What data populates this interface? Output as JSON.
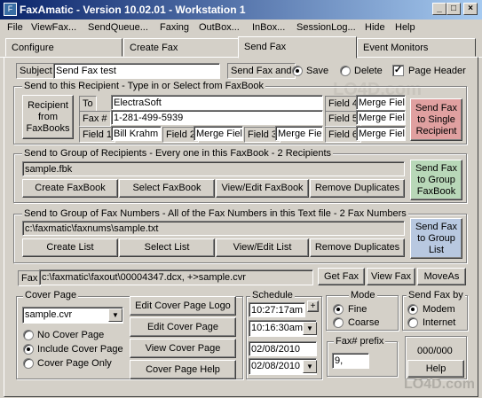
{
  "window": {
    "title": "FaxAmatic - Version 10.02.01 - Workstation 1",
    "icon": "fax-app-icon"
  },
  "menu": [
    "File",
    "ViewFax...",
    "SendQueue...",
    "Faxing",
    "OutBox...",
    "InBox...",
    "SessionLog...",
    "Hide",
    "Help"
  ],
  "tabs": [
    "Configure",
    "Create Fax",
    "Send Fax",
    "Event Monitors"
  ],
  "active_tab": "Send Fax",
  "subject": {
    "label": "Subject",
    "value": "Send Fax test"
  },
  "send_fax_and": {
    "label": "Send Fax and",
    "save_label": "Save",
    "delete_label": "Delete",
    "selected": "Save"
  },
  "page_header": {
    "label": "Page Header",
    "checked": true
  },
  "recipient": {
    "group_title": "Send to this Recipient - Type in or Select from FaxBook",
    "faxbooks_button": "Recipient from FaxBooks",
    "to_label": "To",
    "to_value": "ElectraSoft",
    "fax_label": "Fax #",
    "fax_value": "1-281-499-5939",
    "field1_label": "Field 1",
    "field1_value": "Bill Krahm",
    "field2_label": "Field 2",
    "field2_value": "Merge Fiel",
    "field3_label": "Field 3",
    "field3_value": "Merge Fiel",
    "field4_label": "Field 4",
    "field4_value": "Merge Fiel",
    "field5_label": "Field 5",
    "field5_value": "Merge Fiel",
    "field6_label": "Field 6",
    "field6_value": "Merge Fiel",
    "send_button": "Send Fax to Single Recipient"
  },
  "group_recipients": {
    "title": "Send to Group of Recipients - Every one in this FaxBook - 2 Recipients",
    "file": "sample.fbk",
    "buttons": [
      "Create FaxBook",
      "Select FaxBook",
      "View/Edit FaxBook",
      "Remove Duplicates"
    ],
    "send_button": "Send Fax to Group FaxBook"
  },
  "group_numbers": {
    "title": "Send to Group of Fax Numbers - All of the Fax Numbers in this Text file - 2 Fax Numbers",
    "file": "c:\\faxmatic\\faxnums\\sample.txt",
    "buttons": [
      "Create List",
      "Select List",
      "View/Edit List",
      "Remove Duplicates"
    ],
    "send_button": "Send Fax to Group List"
  },
  "fax_file": {
    "label": "Fax",
    "value": "c:\\faxmatic\\faxout\\00004347.dcx, +>sample.cvr",
    "buttons": [
      "Get Fax",
      "View Fax",
      "MoveAs"
    ]
  },
  "cover_page": {
    "title": "Cover Page",
    "selected": "sample.cvr",
    "options": [
      "No Cover Page",
      "Include Cover Page",
      "Cover Page Only"
    ],
    "selected_option": "Include Cover Page",
    "buttons": [
      "Edit Cover Page Logo",
      "Edit Cover Page",
      "View Cover Page",
      "Cover Page Help"
    ]
  },
  "schedule": {
    "title": "Schedule",
    "time_now": "10:27:17am",
    "time_set": "10:16:30am",
    "date_now": "02/08/2010",
    "date_set": "02/08/2010",
    "plus": "+"
  },
  "mode": {
    "title": "Mode",
    "options": [
      "Fine",
      "Coarse"
    ],
    "selected": "Fine"
  },
  "send_by": {
    "title": "Send Fax by",
    "options": [
      "Modem",
      "Internet"
    ],
    "selected": "Modem"
  },
  "prefix": {
    "label": "Fax# prefix",
    "value": "9,"
  },
  "counter": "000/000",
  "help_button": "Help",
  "watermark": "LO4D.com",
  "colors": {
    "title_start": "#0a246a",
    "title_end": "#a6caf0",
    "send_single": "#e0a0a0",
    "send_group": "#b8d8b8",
    "send_list": "#b8c8e0"
  }
}
